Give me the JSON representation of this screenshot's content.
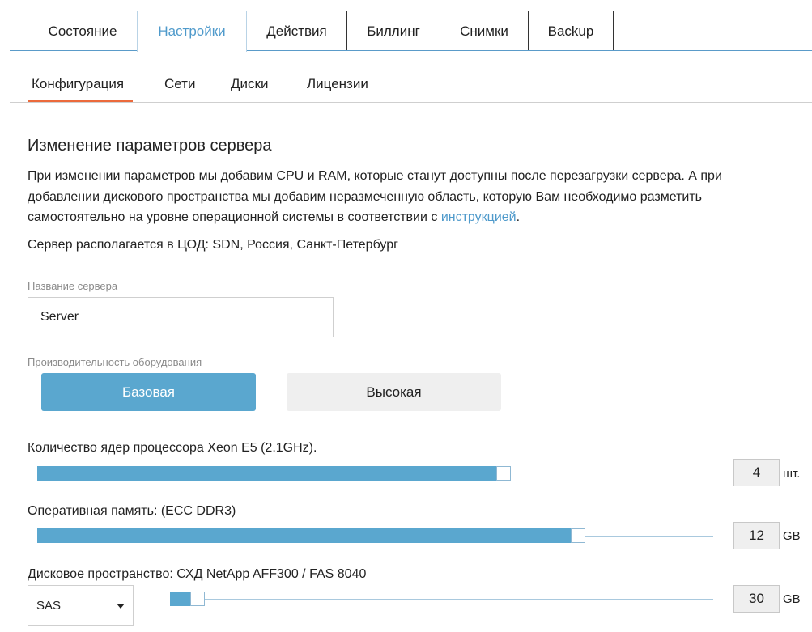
{
  "top_tabs": [
    {
      "label": "Состояние"
    },
    {
      "label": "Настройки"
    },
    {
      "label": "Действия"
    },
    {
      "label": "Биллинг"
    },
    {
      "label": "Снимки"
    },
    {
      "label": "Backup"
    }
  ],
  "active_top_tab": "Настройки",
  "sub_tabs": [
    {
      "label": "Конфигурация"
    },
    {
      "label": "Сети"
    },
    {
      "label": "Диски"
    },
    {
      "label": "Лицензии"
    }
  ],
  "active_sub_tab": "Конфигурация",
  "section": {
    "title": "Изменение параметров сервера",
    "description": "При изменении параметров мы добавим CPU и RAM, которые станут доступны после перезагрузки сервера. А при добавлении дискового пространства мы добавим неразмеченную область, которую Вам необходимо разметить самостоятельно на уровне операционной системы в соответствии с",
    "link_text": "инструкцией",
    "description_end": ".",
    "location": "Сервер располагается в ЦОД: SDN, Россия, Санкт-Петербург"
  },
  "server_name": {
    "label": "Название сервера",
    "value": "Server"
  },
  "performance": {
    "label": "Производительность оборудования",
    "options": [
      "Базовая",
      "Высокая"
    ],
    "selected": "Базовая"
  },
  "sliders": {
    "cpu": {
      "label": "Количество ядер процессора Xeon E5 (2.1GHz).",
      "value": "4",
      "unit": "шт.",
      "fill_fraction": 0.69
    },
    "ram": {
      "label": "Оперативная память: (ECC DDR3)",
      "value": "12",
      "unit": "GB",
      "fill_fraction": 0.8
    },
    "disk": {
      "label": "Дисковое пространство: СХД NetApp AFF300 / FAS 8040",
      "value": "30",
      "unit": "GB",
      "fill_fraction": 0.05,
      "type": "SAS"
    }
  },
  "colors": {
    "accent": "#5aa7cf",
    "active_tab": "#4f9acb",
    "underline": "#ec6a3c",
    "link": "#4f9acb"
  }
}
